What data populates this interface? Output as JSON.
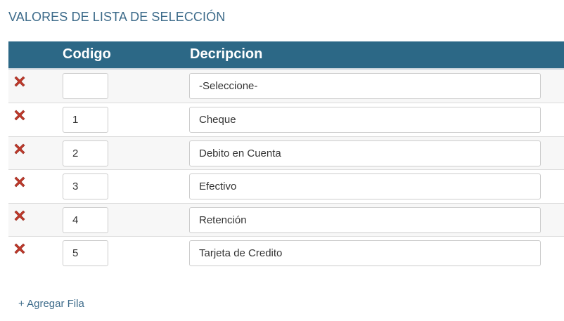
{
  "title": "VALORES DE LISTA DE SELECCIÓN",
  "table": {
    "headers": {
      "codigo": "Codigo",
      "descripcion": "Decripcion"
    },
    "rows": [
      {
        "codigo": "",
        "descripcion": "-Seleccione-"
      },
      {
        "codigo": "1",
        "descripcion": "Cheque"
      },
      {
        "codigo": "2",
        "descripcion": "Debito en Cuenta"
      },
      {
        "codigo": "3",
        "descripcion": "Efectivo"
      },
      {
        "codigo": "4",
        "descripcion": "Retención"
      },
      {
        "codigo": "5",
        "descripcion": "Tarjeta de Credito"
      }
    ]
  },
  "add_row_label": "+ Agregar Fila",
  "colors": {
    "header_bg": "#2c6886",
    "title": "#3d6b8a",
    "delete_icon": "#c0392b"
  },
  "icons": {
    "delete": "delete-x-icon"
  }
}
